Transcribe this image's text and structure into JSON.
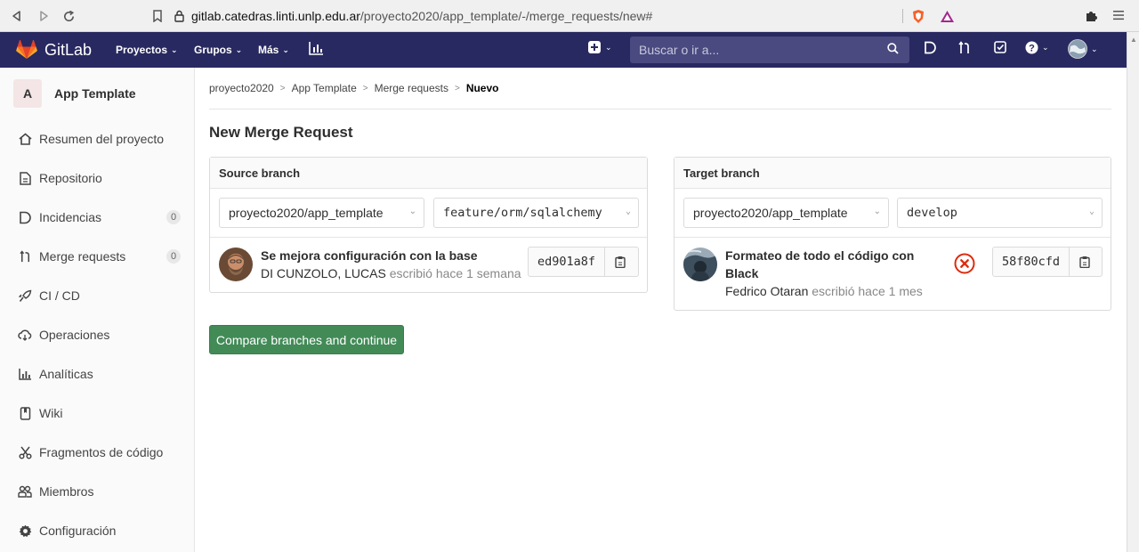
{
  "browser": {
    "url_host": "gitlab.catedras.linti.unlp.edu.ar",
    "url_path": "/proyecto2020/app_template/-/merge_requests/new#"
  },
  "header": {
    "logo_text": "GitLab",
    "menu_projects": "Proyectos",
    "menu_groups": "Grupos",
    "menu_more": "Más",
    "search_placeholder": "Buscar o ir a..."
  },
  "sidebar": {
    "project_initial": "A",
    "project_name": "App Template",
    "items": [
      {
        "label": "Resumen del proyecto",
        "icon": "home-icon"
      },
      {
        "label": "Repositorio",
        "icon": "document-icon"
      },
      {
        "label": "Incidencias",
        "icon": "issues-icon",
        "badge": "0"
      },
      {
        "label": "Merge requests",
        "icon": "merge-request-icon",
        "badge": "0"
      },
      {
        "label": "CI / CD",
        "icon": "rocket-icon"
      },
      {
        "label": "Operaciones",
        "icon": "cloud-icon"
      },
      {
        "label": "Analíticas",
        "icon": "chart-icon"
      },
      {
        "label": "Wiki",
        "icon": "book-icon"
      },
      {
        "label": "Fragmentos de código",
        "icon": "scissors-icon"
      },
      {
        "label": "Miembros",
        "icon": "users-icon"
      },
      {
        "label": "Configuración",
        "icon": "gear-icon"
      }
    ]
  },
  "breadcrumb": [
    "proyecto2020",
    "App Template",
    "Merge requests",
    "Nuevo"
  ],
  "page_title": "New Merge Request",
  "source": {
    "heading": "Source branch",
    "project": "proyecto2020/app_template",
    "branch": "feature/orm/sqlalchemy",
    "commit_title": "Se mejora configuración con la base",
    "author": "DI CUNZOLO, LUCAS",
    "when": "escribió hace 1 semana",
    "sha": "ed901a8f"
  },
  "target": {
    "heading": "Target branch",
    "project": "proyecto2020/app_template",
    "branch": "develop",
    "commit_title_line1": "Formateo de todo el código con",
    "commit_title_line2": "Black",
    "author": "Fedrico Otaran",
    "when": "escribió hace 1 mes",
    "sha": "58f80cfd"
  },
  "compare_button": "Compare branches and continue",
  "colors": {
    "header": "#292961",
    "primary_button": "#428b57",
    "pipeline_failed": "#dd2b0e"
  }
}
